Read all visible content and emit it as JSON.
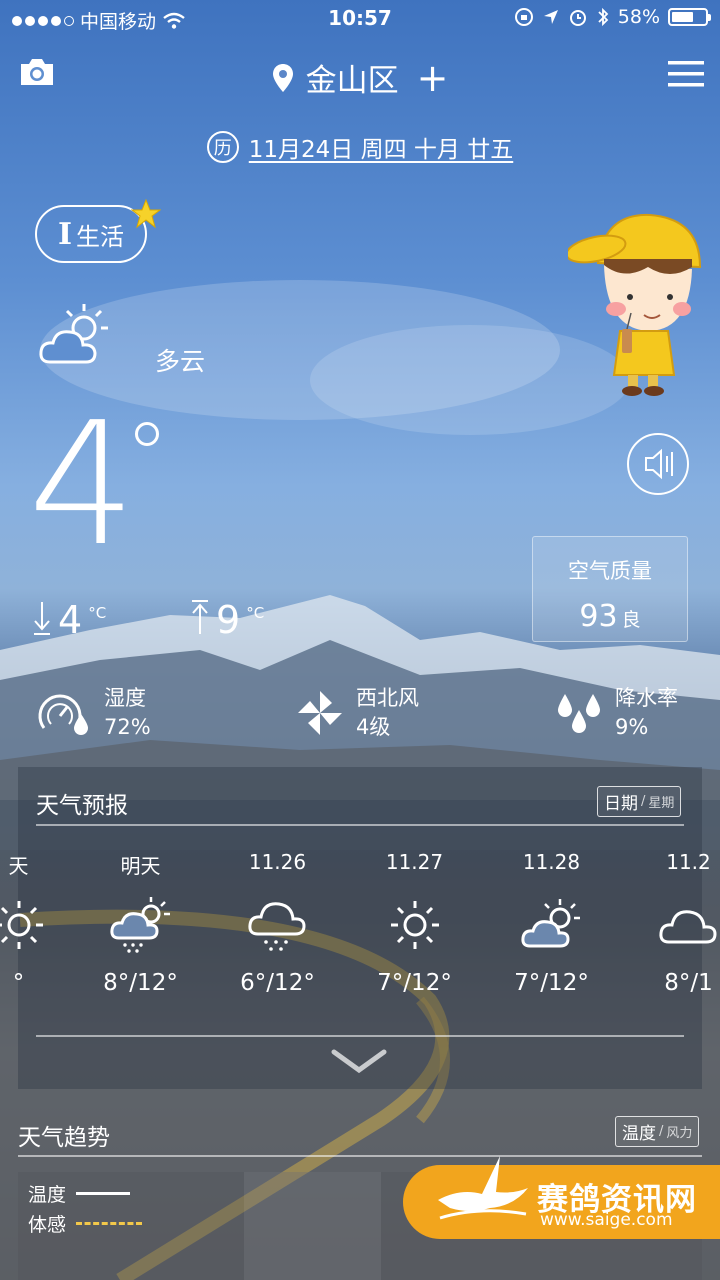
{
  "status_bar": {
    "carrier": "中国移动",
    "time": "10:57",
    "battery": "58%"
  },
  "header": {
    "location": "金山区",
    "add_symbol": "+",
    "date_badge": "历",
    "date": "11月24日 周四  十月 廿五"
  },
  "life": {
    "big": "I",
    "label": "生活"
  },
  "current": {
    "condition": "多云",
    "temperature": "4",
    "low": "4",
    "high": "9",
    "unit": "°C",
    "air_quality": {
      "title": "空气质量",
      "value": "93",
      "level": "良"
    },
    "humidity": {
      "label": "湿度",
      "value": "72%"
    },
    "wind": {
      "label": "西北风",
      "value": "4级"
    },
    "precip": {
      "label": "降水率",
      "value": "9%"
    }
  },
  "forecast": {
    "title": "天气预报",
    "toggle_active": "日期",
    "toggle_sep": "/",
    "toggle_inactive": "星期",
    "days": [
      {
        "label": "天",
        "icon": "sun-icon",
        "temp": "°"
      },
      {
        "label": "明天",
        "icon": "cloud-sun-rain-icon",
        "temp": "8°/12°"
      },
      {
        "label": "11.26",
        "icon": "cloud-rain-icon",
        "temp": "6°/12°"
      },
      {
        "label": "11.27",
        "icon": "sun-icon",
        "temp": "7°/12°"
      },
      {
        "label": "11.28",
        "icon": "cloud-sun-icon",
        "temp": "7°/12°"
      },
      {
        "label": "11.2",
        "icon": "cloud-icon",
        "temp": "8°/1"
      }
    ]
  },
  "trend": {
    "title": "天气趋势",
    "toggle_active": "温度",
    "toggle_sep": "/",
    "toggle_inactive": "风力",
    "legend_temp": "温度",
    "legend_feel": "体感"
  },
  "watermark": {
    "name": "赛鸽资讯网",
    "url": "www.saige.com"
  },
  "colors": {
    "accent_yellow": "#f2c84a",
    "watermark": "#f2a51d"
  }
}
